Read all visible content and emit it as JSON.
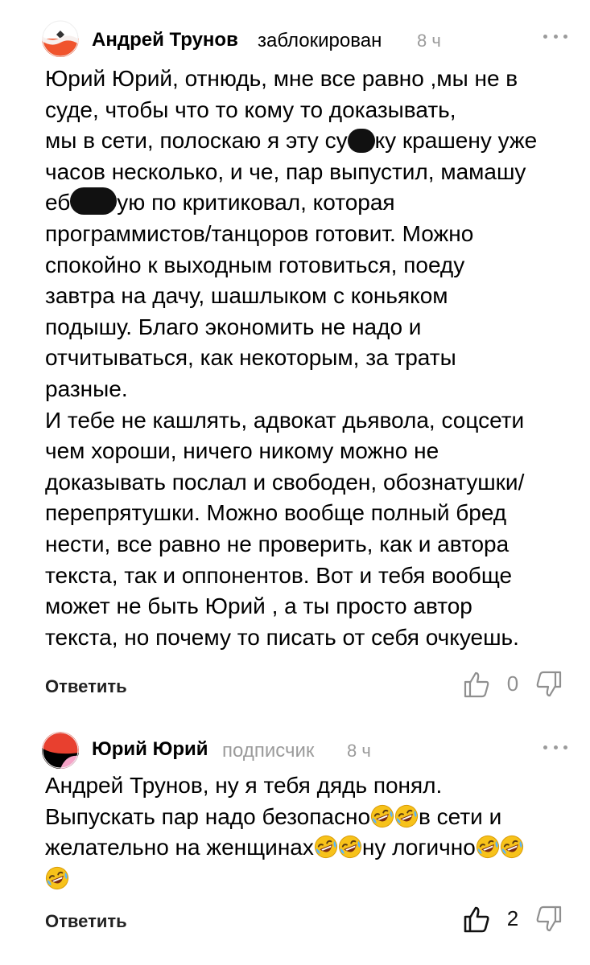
{
  "comments": [
    {
      "author": "Андрей Трунов",
      "role": "заблокирован",
      "time": "8 ч",
      "text": {
        "p1_l1": "Юрий Юрий, отнюдь, мне все равно ,мы не в",
        "p1_l2": "суде, чтобы что то кому то доказывать,",
        "p1_l3a": "мы в сети, полоскаю я эту су",
        "p1_l3b": "ку крашену уже",
        "p1_l4": "часов несколько, и че, пар выпустил, мамашу",
        "p1_l5a": "еб",
        "p1_l5b": "ую по критиковал, которая",
        "p1_l6": "программистов/танцоров готовит. Можно",
        "p1_l7": "спокойно к выходным готовиться, поеду",
        "p1_l8": "завтра на дачу, шашлыком с коньяком",
        "p1_l9": "подышу. Благо экономить не надо и",
        "p1_l10": "отчитываться, как некоторым, за траты",
        "p1_l11": "разные.",
        "p2_l1": "И тебе не кашлять, адвокат дьявола, соцсети",
        "p2_l2": "чем хороши, ничего никому можно не",
        "p2_l3": "доказывать послал и свободен, обознатушки/",
        "p2_l4": "перепрятушки. Можно вообще полный бред",
        "p2_l5": "нести, все равно не проверить, как и автора",
        "p2_l6": "текста, так и оппонентов. Вот и тебя вообще",
        "p2_l7": "может не быть Юрий , а ты просто автор",
        "p2_l8": "текста, но почему то писать от себя очкуешь."
      },
      "reply_label": "Ответить",
      "likes": "0",
      "avatar_colors": [
        "#f0542d",
        "#ffffff"
      ]
    },
    {
      "author": "Юрий Юрий",
      "role": "подписчик",
      "time": "8 ч",
      "text": {
        "l1": "Андрей Трунов, ну я тебя дядь понял.",
        "l2a": "Выпускать пар надо безопасно",
        "l2b": "в сети и",
        "l3a": "желательно на женщинах",
        "l3b": "ну логично"
      },
      "emoji": "rolling-on-floor-laughing",
      "reply_label": "Ответить",
      "likes": "2",
      "avatar_colors": [
        "#e8402f",
        "#000000",
        "#f5a3c7"
      ]
    }
  ]
}
